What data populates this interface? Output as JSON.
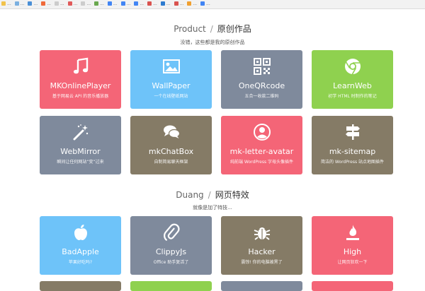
{
  "bookmarks": [
    {
      "label": "...",
      "color": "#f1c24b"
    },
    {
      "label": "...",
      "color": "#7bb0e0"
    },
    {
      "label": "...",
      "color": "#4a8fd6"
    },
    {
      "label": "...",
      "color": "#ef6a3a"
    },
    {
      "label": "...",
      "color": "#cccccc"
    },
    {
      "label": "...",
      "color": "#e05a5a"
    },
    {
      "label": "...",
      "color": "#cccccc"
    },
    {
      "label": "...",
      "color": "#6aa84f"
    },
    {
      "label": "...",
      "color": "#4285f4"
    },
    {
      "label": "...",
      "color": "#4285f4"
    },
    {
      "label": "...",
      "color": "#4285f4"
    },
    {
      "label": "...",
      "color": "#d9534f"
    },
    {
      "label": "...",
      "color": "#2e7bcf"
    },
    {
      "label": "...",
      "color": "#d9534f"
    },
    {
      "label": "...",
      "color": "#f0a030"
    },
    {
      "label": "...",
      "color": "#4285f4"
    }
  ],
  "sections": [
    {
      "title_en": "Product",
      "title_sep": "/",
      "title_cn": "原创作品",
      "subtitle": "没错，这些都是我的原创作品",
      "cards": [
        {
          "name": "MKOnlinePlayer",
          "desc": "基于网易云 API 的音乐播放器",
          "color": "#f46577",
          "icon": "music-note-icon"
        },
        {
          "name": "WallPaper",
          "desc": "一个在线壁纸网站",
          "color": "#6ec3f9",
          "icon": "picture-icon"
        },
        {
          "name": "OneQRcode",
          "desc": "五合一收款二维码",
          "color": "#7f8a9c",
          "icon": "qrcode-icon"
        },
        {
          "name": "LearnWeb",
          "desc": "初学 HTML 时制作的笔记",
          "color": "#8fd14f",
          "icon": "chrome-icon"
        },
        {
          "name": "WebMirror",
          "desc": "瞬间让任何网站“变”过来",
          "color": "#7f8a9c",
          "icon": "magic-wand-icon"
        },
        {
          "name": "mkChatBox",
          "desc": "自制简易聊天框架",
          "color": "#857b66",
          "icon": "chat-bubbles-icon"
        },
        {
          "name": "mk-letter-avatar",
          "desc": "纯前端 WordPress 字母头像插件",
          "color": "#f46577",
          "icon": "user-avatar-icon"
        },
        {
          "name": "mk-sitemap",
          "desc": "简洁的 WordPress 站点地图插件",
          "color": "#857b66",
          "icon": "signpost-icon"
        }
      ]
    },
    {
      "title_en": "Duang",
      "title_sep": "/",
      "title_cn": "网页特效",
      "subtitle": "就像是加了特技...",
      "cards": [
        {
          "name": "BadApple",
          "desc": "苹果好吃吗?",
          "color": "#6ec3f9",
          "icon": "apple-icon"
        },
        {
          "name": "ClippyJs",
          "desc": "Office 助手复活了",
          "color": "#7f8a9c",
          "icon": "paperclip-icon"
        },
        {
          "name": "Hacker",
          "desc": "震惊! 你的电脑被黑了",
          "color": "#857b66",
          "icon": "bug-icon"
        },
        {
          "name": "High",
          "desc": "让网页狂欢一下",
          "color": "#f46577",
          "icon": "flame-icon"
        }
      ]
    }
  ],
  "partial_row_colors": [
    "#857b66",
    "#8fd14f",
    "#7f8a9c",
    "#f46577"
  ]
}
